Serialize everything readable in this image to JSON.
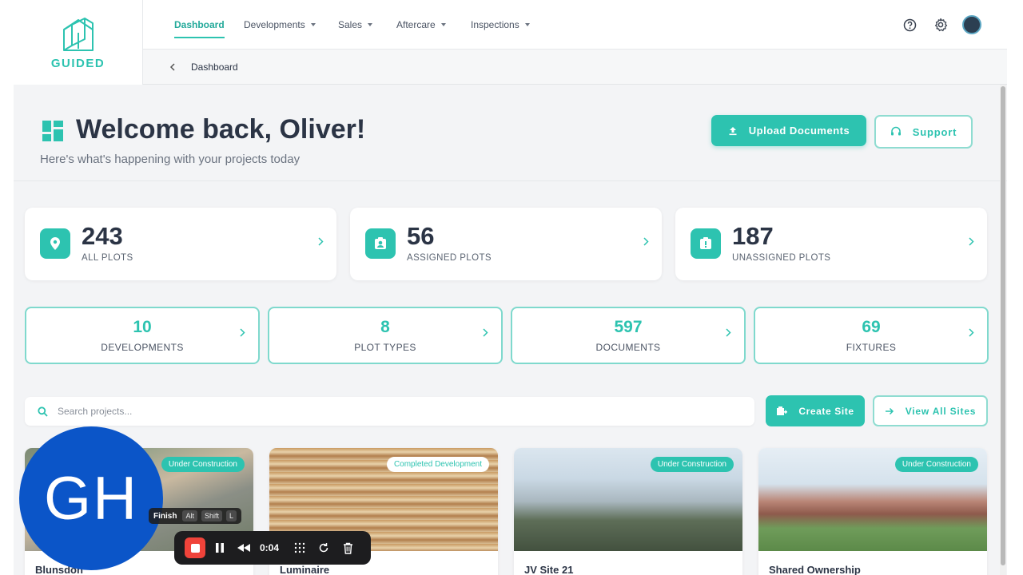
{
  "brand": {
    "name": "GUIDED",
    "accent": "#2dc3b0"
  },
  "nav": {
    "items": [
      {
        "label": "Dashboard",
        "active": true,
        "dropdown": false
      },
      {
        "label": "Developments",
        "active": false,
        "dropdown": true
      },
      {
        "label": "Sales",
        "active": false,
        "dropdown": true
      },
      {
        "label": "Aftercare",
        "active": false,
        "dropdown": true
      },
      {
        "label": "Inspections",
        "active": false,
        "dropdown": true
      }
    ],
    "icons": [
      "help-icon",
      "gear-icon",
      "user-avatar"
    ]
  },
  "breadcrumb": {
    "current": "Dashboard"
  },
  "header": {
    "title": "Welcome back, Oliver!",
    "subtitle": "Here's what's happening with your projects today",
    "upload_label": "Upload Documents",
    "support_label": "Support"
  },
  "stats": [
    {
      "value": "243",
      "label": "ALL PLOTS",
      "icon": "map-pin-icon"
    },
    {
      "value": "56",
      "label": "ASSIGNED PLOTS",
      "icon": "assigned-user-icon"
    },
    {
      "value": "187",
      "label": "UNASSIGNED PLOTS",
      "icon": "alert-icon"
    }
  ],
  "mini_stats": [
    {
      "value": "10",
      "label": "DEVELOPMENTS"
    },
    {
      "value": "8",
      "label": "PLOT TYPES"
    },
    {
      "value": "597",
      "label": "DOCUMENTS"
    },
    {
      "value": "69",
      "label": "FIXTURES"
    }
  ],
  "search": {
    "placeholder": "Search projects...",
    "value": ""
  },
  "actions": {
    "create_label": "Create Site",
    "view_all_label": "View All Sites"
  },
  "projects": [
    {
      "name": "Blunsdon",
      "status": "Under Construction"
    },
    {
      "name": "Luminaire",
      "status": "Completed Development"
    },
    {
      "name": "JV Site 21",
      "status": "Under Construction"
    },
    {
      "name": "Shared Ownership",
      "status": "Under Construction"
    }
  ],
  "recorder": {
    "avatar_initials": "GH",
    "shortcut_label": "Finish",
    "shortcut_keys": [
      "Alt",
      "Shift",
      "L"
    ],
    "elapsed": "0:04"
  }
}
